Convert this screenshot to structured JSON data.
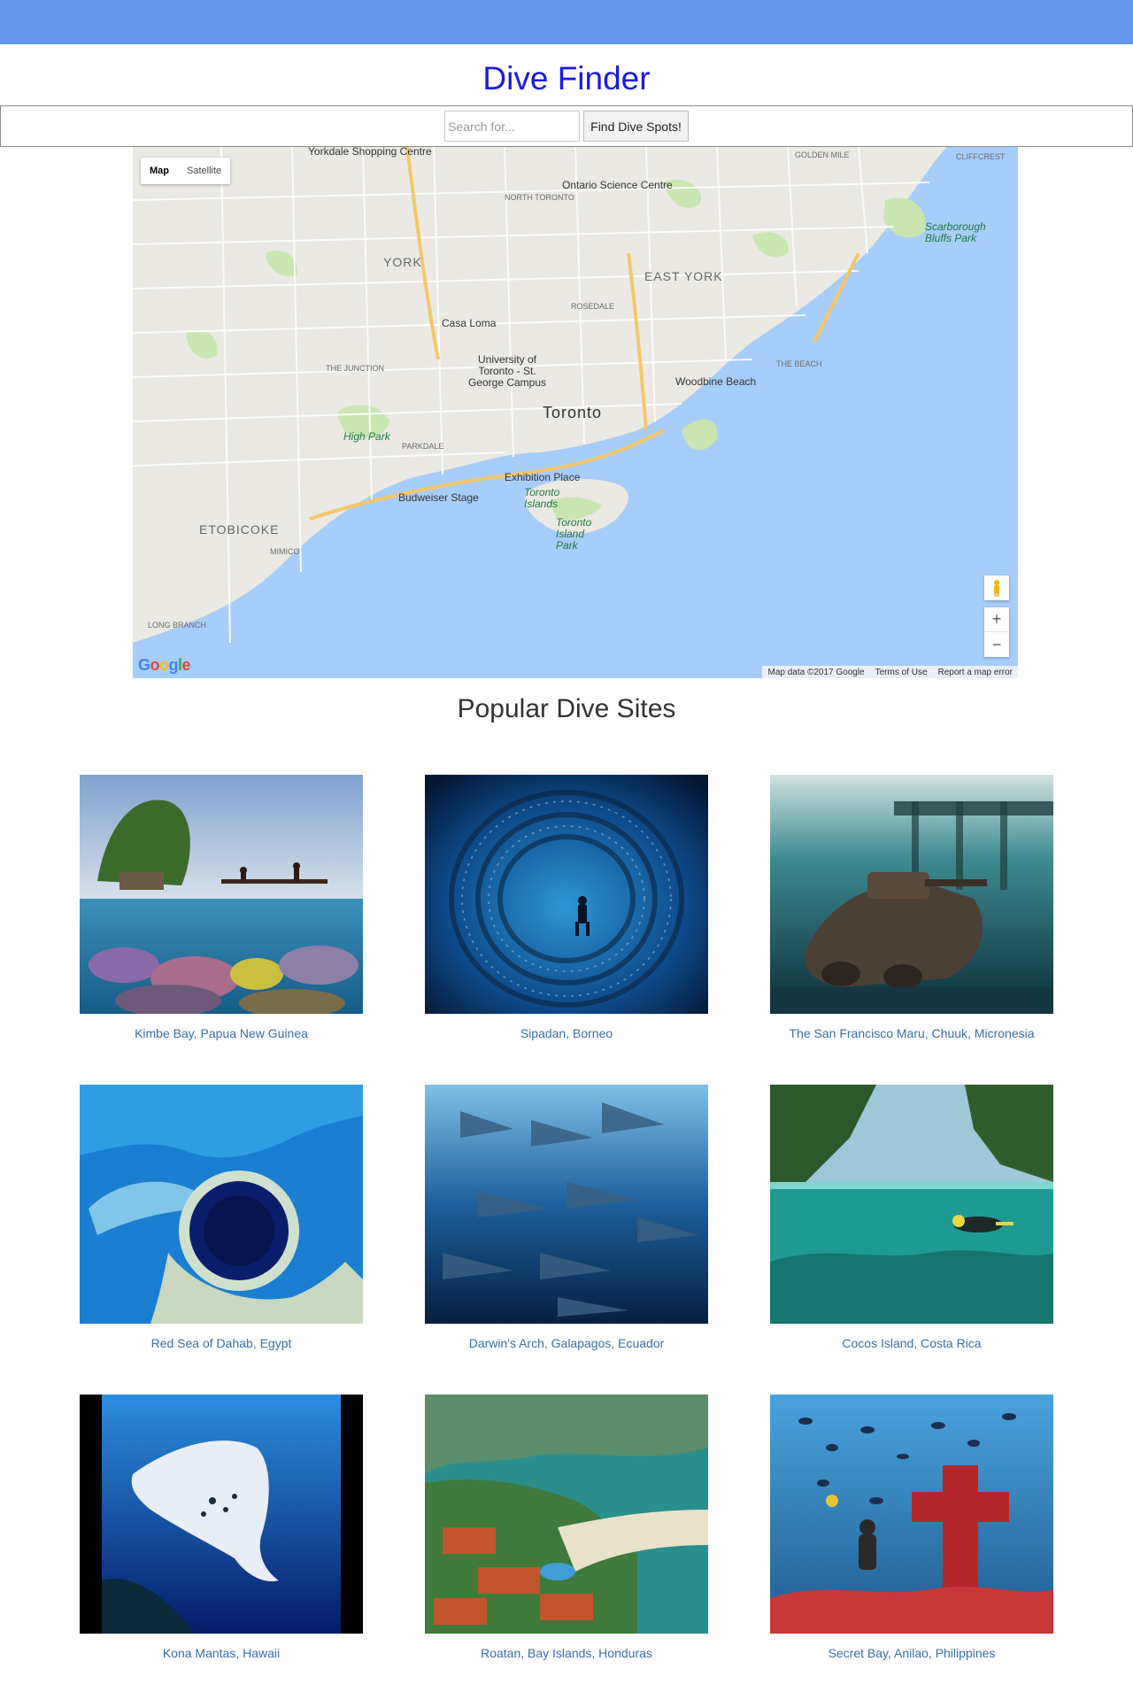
{
  "app": {
    "title": "Dive Finder"
  },
  "search": {
    "placeholder": "Search for...",
    "button_label": "Find Dive Spots!"
  },
  "map": {
    "type_options": [
      "Map",
      "Satellite"
    ],
    "selected_type": "Map",
    "zoom_in": "+",
    "zoom_out": "−",
    "logo": "Google",
    "attribution": [
      "Map data ©2017 Google",
      "Terms of Use",
      "Report a map error"
    ],
    "labels": {
      "toronto": "Toronto",
      "york": "YORK",
      "east_york": "EAST YORK",
      "etobicoke": "ETOBICOKE",
      "yorkdale": "Yorkdale Shopping Centre",
      "ontario_science": "Ontario Science Centre",
      "casa_loma": "Casa Loma",
      "uoft": "University of Toronto - St. George Campus",
      "exhibition": "Exhibition Place",
      "budweiser": "Budweiser Stage",
      "toronto_islands": "Toronto Islands",
      "island_park": "Toronto Island Park",
      "high_park": "High Park",
      "woodbine": "Woodbine Beach",
      "scarborough": "Scarborough Bluffs Park",
      "north_toronto": "NORTH TORONTO",
      "rosedale": "ROSEDALE",
      "the_junction": "THE JUNCTION",
      "parkdale": "PARKDALE",
      "mimico": "MIMICO",
      "long_branch": "LONG BRANCH",
      "golden_mile": "GOLDEN MILE",
      "cliffcrest": "CLIFFCREST",
      "the_beach": "THE BEACH"
    }
  },
  "popular": {
    "heading": "Popular Dive Sites",
    "sites": [
      {
        "name": "Kimbe Bay, Papua New Guinea",
        "image": "coral-reef-split-view"
      },
      {
        "name": "Sipadan, Borneo",
        "image": "fish-tornado"
      },
      {
        "name": "The San Francisco Maru, Chuuk, Micronesia",
        "image": "shipwreck-tank"
      },
      {
        "name": "Red Sea of Dahab, Egypt",
        "image": "blue-hole"
      },
      {
        "name": "Darwin's Arch, Galapagos, Ecuador",
        "image": "hammerhead-school"
      },
      {
        "name": "Cocos Island, Costa Rica",
        "image": "diver-lagoon"
      },
      {
        "name": "Kona Mantas, Hawaii",
        "image": "manta-ray"
      },
      {
        "name": "Roatan, Bay Islands, Honduras",
        "image": "resort-aerial"
      },
      {
        "name": "Secret Bay, Anilao, Philippines",
        "image": "reef-cross-diver"
      }
    ]
  },
  "colors": {
    "topbar": "#6495ed",
    "title": "#1a1ae6",
    "link": "#3a6ea5",
    "water": "#a7cdfa",
    "park": "#c9e6b1"
  }
}
